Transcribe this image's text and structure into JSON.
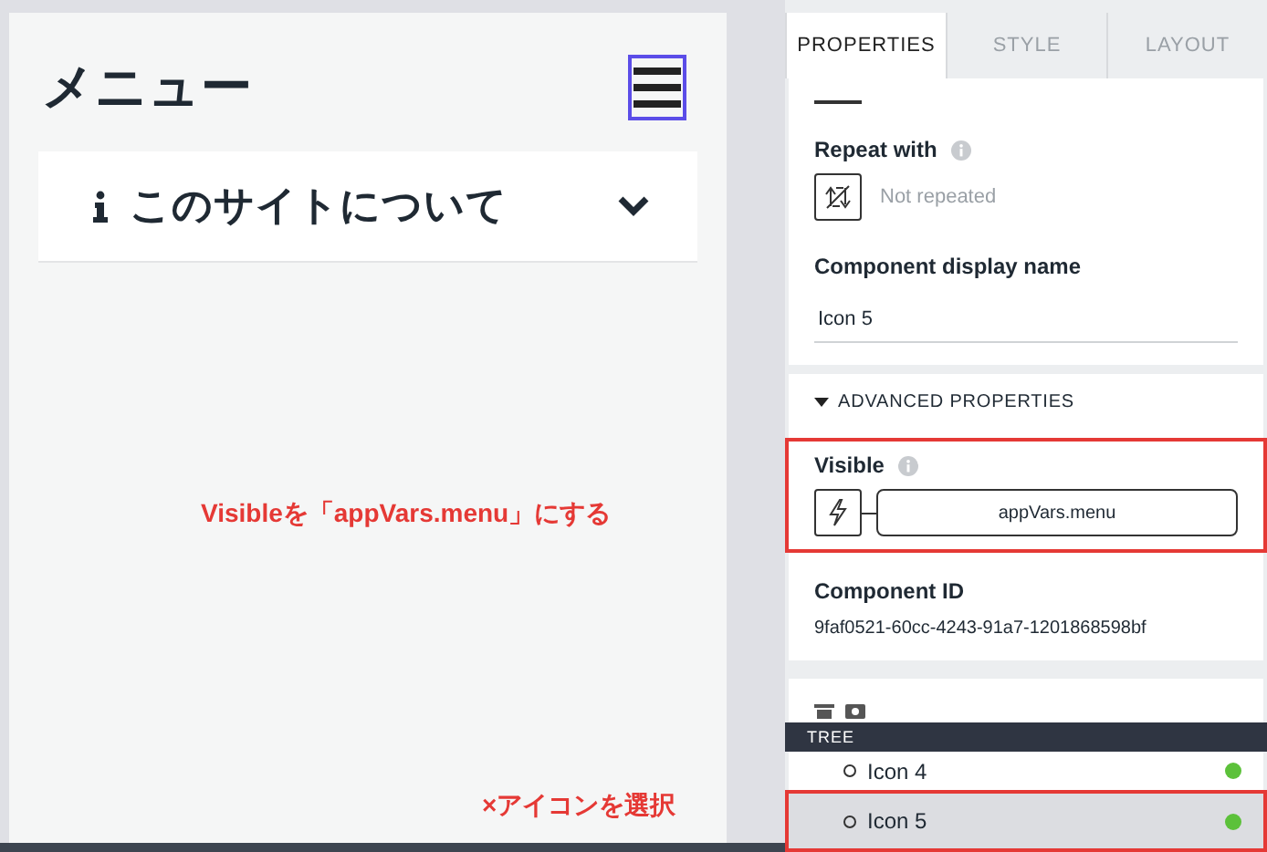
{
  "canvas": {
    "title": "メニュー",
    "menu_icon": {
      "selected": true
    },
    "accordion": {
      "label": "このサイトについて",
      "expanded": false
    }
  },
  "annotations": [
    {
      "text": "Visibleを「appVars.menu」にする"
    },
    {
      "text": "×アイコンを選択"
    }
  ],
  "properties_panel": {
    "tabs": [
      {
        "label": "PROPERTIES",
        "selected": true
      },
      {
        "label": "STYLE",
        "selected": false
      },
      {
        "label": "LAYOUT",
        "selected": false
      }
    ],
    "repeat_with": {
      "label": "Repeat with",
      "value": "Not repeated"
    },
    "display_name": {
      "label": "Component display name",
      "value": "Icon 5"
    },
    "advanced": {
      "label": "ADVANCED PROPERTIES",
      "expanded": true
    },
    "visible": {
      "label": "Visible",
      "value": "appVars.menu",
      "highlighted": true
    },
    "component_id": {
      "label": "Component ID",
      "value": "9faf0521-60cc-4243-91a7-1201868598bf"
    }
  },
  "tree": {
    "title": "TREE",
    "items": [
      {
        "label": "Icon 4",
        "selected": false,
        "highlighted": false
      },
      {
        "label": "Icon 5",
        "selected": true,
        "highlighted": true
      }
    ]
  }
}
